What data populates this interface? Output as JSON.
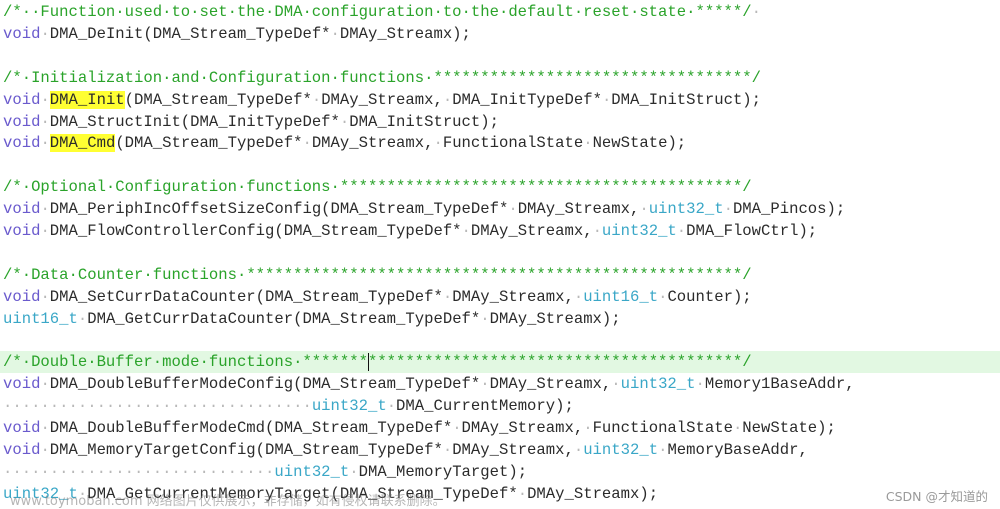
{
  "editor": {
    "lines": [
      {
        "segments": [
          {
            "cls": "tok-comment",
            "text": "/*··Function·used·to·set·the·DMA·configuration·to·the·default·reset·state·"
          },
          {
            "cls": "tok-stars",
            "text": "*****/"
          },
          {
            "cls": "ws",
            "text": "·"
          }
        ]
      },
      {
        "segments": [
          {
            "cls": "tok-kw",
            "text": "void"
          },
          {
            "cls": "ws",
            "text": "·"
          },
          {
            "cls": "tok-plain",
            "text": "DMA_DeInit(DMA_Stream_TypeDef*"
          },
          {
            "cls": "ws",
            "text": "·"
          },
          {
            "cls": "tok-plain",
            "text": "DMAy_Streamx);"
          }
        ]
      },
      {
        "segments": []
      },
      {
        "segments": [
          {
            "cls": "tok-comment",
            "text": "/*·Initialization·and·Configuration·functions·"
          },
          {
            "cls": "tok-stars",
            "text": "**********************************/"
          }
        ]
      },
      {
        "segments": [
          {
            "cls": "tok-kw",
            "text": "void"
          },
          {
            "cls": "ws",
            "text": "·"
          },
          {
            "cls": "tok-plain tok-hl",
            "text": "DMA_Init"
          },
          {
            "cls": "tok-plain",
            "text": "(DMA_Stream_TypeDef*"
          },
          {
            "cls": "ws",
            "text": "·"
          },
          {
            "cls": "tok-plain",
            "text": "DMAy_Streamx,"
          },
          {
            "cls": "ws",
            "text": "·"
          },
          {
            "cls": "tok-plain",
            "text": "DMA_InitTypeDef*"
          },
          {
            "cls": "ws",
            "text": "·"
          },
          {
            "cls": "tok-plain",
            "text": "DMA_InitStruct);"
          }
        ]
      },
      {
        "segments": [
          {
            "cls": "tok-kw",
            "text": "void"
          },
          {
            "cls": "ws",
            "text": "·"
          },
          {
            "cls": "tok-plain",
            "text": "DMA_StructInit(DMA_InitTypeDef*"
          },
          {
            "cls": "ws",
            "text": "·"
          },
          {
            "cls": "tok-plain",
            "text": "DMA_InitStruct);"
          }
        ]
      },
      {
        "segments": [
          {
            "cls": "tok-kw",
            "text": "void"
          },
          {
            "cls": "ws",
            "text": "·"
          },
          {
            "cls": "tok-plain tok-hl",
            "text": "DMA_Cmd"
          },
          {
            "cls": "tok-plain",
            "text": "(DMA_Stream_TypeDef*"
          },
          {
            "cls": "ws",
            "text": "·"
          },
          {
            "cls": "tok-plain",
            "text": "DMAy_Streamx,"
          },
          {
            "cls": "ws",
            "text": "·"
          },
          {
            "cls": "tok-plain",
            "text": "FunctionalState"
          },
          {
            "cls": "ws",
            "text": "·"
          },
          {
            "cls": "tok-plain",
            "text": "NewState);"
          }
        ]
      },
      {
        "segments": []
      },
      {
        "segments": [
          {
            "cls": "tok-comment",
            "text": "/*·Optional·Configuration·functions·"
          },
          {
            "cls": "tok-stars",
            "text": "*******************************************/"
          }
        ]
      },
      {
        "segments": [
          {
            "cls": "tok-kw",
            "text": "void"
          },
          {
            "cls": "ws",
            "text": "·"
          },
          {
            "cls": "tok-plain",
            "text": "DMA_PeriphIncOffsetSizeConfig(DMA_Stream_TypeDef*"
          },
          {
            "cls": "ws",
            "text": "·"
          },
          {
            "cls": "tok-plain",
            "text": "DMAy_Streamx,"
          },
          {
            "cls": "ws",
            "text": "·"
          },
          {
            "cls": "tok-type",
            "text": "uint32_t"
          },
          {
            "cls": "ws",
            "text": "·"
          },
          {
            "cls": "tok-plain",
            "text": "DMA_Pincos);"
          }
        ]
      },
      {
        "segments": [
          {
            "cls": "tok-kw",
            "text": "void"
          },
          {
            "cls": "ws",
            "text": "·"
          },
          {
            "cls": "tok-plain",
            "text": "DMA_FlowControllerConfig(DMA_Stream_TypeDef*"
          },
          {
            "cls": "ws",
            "text": "·"
          },
          {
            "cls": "tok-plain",
            "text": "DMAy_Streamx,"
          },
          {
            "cls": "ws",
            "text": "·"
          },
          {
            "cls": "tok-type",
            "text": "uint32_t"
          },
          {
            "cls": "ws",
            "text": "·"
          },
          {
            "cls": "tok-plain",
            "text": "DMA_FlowCtrl);"
          }
        ]
      },
      {
        "segments": []
      },
      {
        "segments": [
          {
            "cls": "tok-comment",
            "text": "/*·Data·Counter·functions·"
          },
          {
            "cls": "tok-stars",
            "text": "*****************************************************/"
          }
        ]
      },
      {
        "segments": [
          {
            "cls": "tok-kw",
            "text": "void"
          },
          {
            "cls": "ws",
            "text": "·"
          },
          {
            "cls": "tok-plain",
            "text": "DMA_SetCurrDataCounter(DMA_Stream_TypeDef*"
          },
          {
            "cls": "ws",
            "text": "·"
          },
          {
            "cls": "tok-plain",
            "text": "DMAy_Streamx,"
          },
          {
            "cls": "ws",
            "text": "·"
          },
          {
            "cls": "tok-type",
            "text": "uint16_t"
          },
          {
            "cls": "ws",
            "text": "·"
          },
          {
            "cls": "tok-plain",
            "text": "Counter);"
          }
        ]
      },
      {
        "segments": [
          {
            "cls": "tok-type",
            "text": "uint16_t"
          },
          {
            "cls": "ws",
            "text": "·"
          },
          {
            "cls": "tok-plain",
            "text": "DMA_GetCurrDataCounter(DMA_Stream_TypeDef*"
          },
          {
            "cls": "ws",
            "text": "·"
          },
          {
            "cls": "tok-plain",
            "text": "DMAy_Streamx);"
          }
        ]
      },
      {
        "segments": []
      },
      {
        "current": true,
        "segments": [
          {
            "cls": "tok-comment",
            "text": "/*·Double·Buffer·mode·functions·"
          },
          {
            "cls": "tok-stars",
            "text": "*******"
          },
          {
            "cls": "caret",
            "text": ""
          },
          {
            "cls": "tok-stars",
            "text": "****************************************/"
          }
        ]
      },
      {
        "segments": [
          {
            "cls": "tok-kw",
            "text": "void"
          },
          {
            "cls": "ws",
            "text": "·"
          },
          {
            "cls": "tok-plain",
            "text": "DMA_DoubleBufferModeConfig(DMA_Stream_TypeDef*"
          },
          {
            "cls": "ws",
            "text": "·"
          },
          {
            "cls": "tok-plain",
            "text": "DMAy_Streamx,"
          },
          {
            "cls": "ws",
            "text": "·"
          },
          {
            "cls": "tok-type",
            "text": "uint32_t"
          },
          {
            "cls": "ws",
            "text": "·"
          },
          {
            "cls": "tok-plain",
            "text": "Memory1BaseAddr,"
          }
        ]
      },
      {
        "segments": [
          {
            "cls": "ws",
            "text": "·································"
          },
          {
            "cls": "tok-type",
            "text": "uint32_t"
          },
          {
            "cls": "ws",
            "text": "·"
          },
          {
            "cls": "tok-plain",
            "text": "DMA_CurrentMemory);"
          }
        ]
      },
      {
        "segments": [
          {
            "cls": "tok-kw",
            "text": "void"
          },
          {
            "cls": "ws",
            "text": "·"
          },
          {
            "cls": "tok-plain",
            "text": "DMA_DoubleBufferModeCmd(DMA_Stream_TypeDef*"
          },
          {
            "cls": "ws",
            "text": "·"
          },
          {
            "cls": "tok-plain",
            "text": "DMAy_Streamx,"
          },
          {
            "cls": "ws",
            "text": "·"
          },
          {
            "cls": "tok-plain",
            "text": "FunctionalState"
          },
          {
            "cls": "ws",
            "text": "·"
          },
          {
            "cls": "tok-plain",
            "text": "NewState);"
          }
        ]
      },
      {
        "segments": [
          {
            "cls": "tok-kw",
            "text": "void"
          },
          {
            "cls": "ws",
            "text": "·"
          },
          {
            "cls": "tok-plain",
            "text": "DMA_MemoryTargetConfig(DMA_Stream_TypeDef*"
          },
          {
            "cls": "ws",
            "text": "·"
          },
          {
            "cls": "tok-plain",
            "text": "DMAy_Streamx,"
          },
          {
            "cls": "ws",
            "text": "·"
          },
          {
            "cls": "tok-type",
            "text": "uint32_t"
          },
          {
            "cls": "ws",
            "text": "·"
          },
          {
            "cls": "tok-plain",
            "text": "MemoryBaseAddr,"
          }
        ]
      },
      {
        "segments": [
          {
            "cls": "ws",
            "text": "·····························"
          },
          {
            "cls": "tok-type",
            "text": "uint32_t"
          },
          {
            "cls": "ws",
            "text": "·"
          },
          {
            "cls": "tok-plain",
            "text": "DMA_MemoryTarget);"
          }
        ]
      },
      {
        "segments": [
          {
            "cls": "tok-type",
            "text": "uint32_t"
          },
          {
            "cls": "ws",
            "text": "·"
          },
          {
            "cls": "tok-plain",
            "text": "DMA_GetCurrentMemoryTarget(DMA_Stream_TypeDef*"
          },
          {
            "cls": "ws",
            "text": "·"
          },
          {
            "cls": "tok-plain",
            "text": "DMAy_Streamx);"
          }
        ]
      }
    ]
  },
  "watermarks": {
    "left": "www.toymoban.com 网络图片仅供展示，非存储，如有侵权请联系删除。",
    "right": "CSDN @才知道的"
  },
  "colors": {
    "comment": "#2aa32a",
    "keyword": "#6a5acd",
    "type": "#3aa7c7",
    "highlight": "#ffff33",
    "current_line": "#e2f8e2"
  }
}
